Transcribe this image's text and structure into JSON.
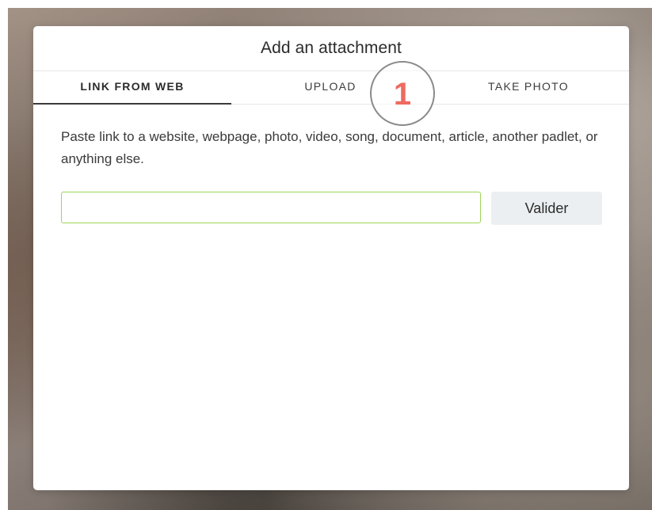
{
  "dialog": {
    "title": "Add an attachment",
    "tabs": [
      {
        "label": "LINK FROM WEB",
        "active": true
      },
      {
        "label": "UPLOAD",
        "active": false
      },
      {
        "label": "TAKE PHOTO",
        "active": false
      }
    ],
    "description": "Paste link to a website, webpage, photo, video, song, document, article, another padlet, or anything else.",
    "url_input": {
      "value": "",
      "placeholder": ""
    },
    "validate_label": "Valider"
  },
  "annotation": {
    "step_number": "1",
    "color": "#ef6a60"
  },
  "colors": {
    "input_border": "#9dd45a",
    "button_bg": "#eceff1"
  }
}
